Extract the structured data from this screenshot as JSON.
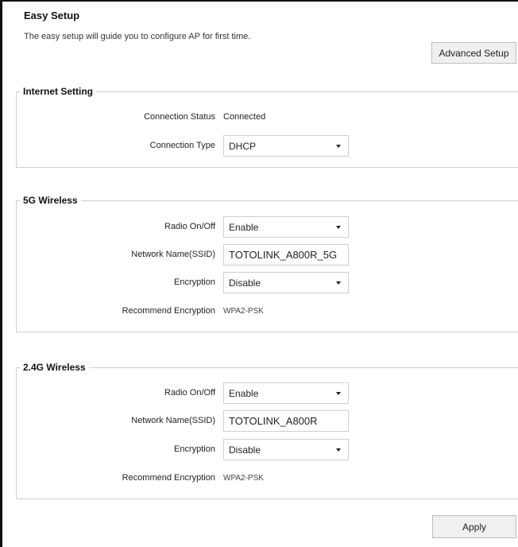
{
  "header": {
    "title": "Easy Setup",
    "description": "The easy setup will guide you to configure AP for first time.",
    "advanced_button": "Advanced Setup"
  },
  "internet": {
    "legend": "Internet Setting",
    "status_label": "Connection Status",
    "status_value": "Connected",
    "type_label": "Connection Type",
    "type_value": "DHCP"
  },
  "wireless_5g": {
    "legend": "5G Wireless",
    "radio_label": "Radio On/Off",
    "radio_value": "Enable",
    "ssid_label": "Network Name(SSID)",
    "ssid_value": "TOTOLINK_A800R_5G",
    "encryption_label": "Encryption",
    "encryption_value": "Disable",
    "recommend_label": "Recommend Encryption",
    "recommend_value": "WPA2-PSK"
  },
  "wireless_24g": {
    "legend": "2.4G Wireless",
    "radio_label": "Radio On/Off",
    "radio_value": "Enable",
    "ssid_label": "Network Name(SSID)",
    "ssid_value": "TOTOLINK_A800R",
    "encryption_label": "Encryption",
    "encryption_value": "Disable",
    "recommend_label": "Recommend Encryption",
    "recommend_value": "WPA2-PSK"
  },
  "footer": {
    "apply_button": "Apply"
  }
}
